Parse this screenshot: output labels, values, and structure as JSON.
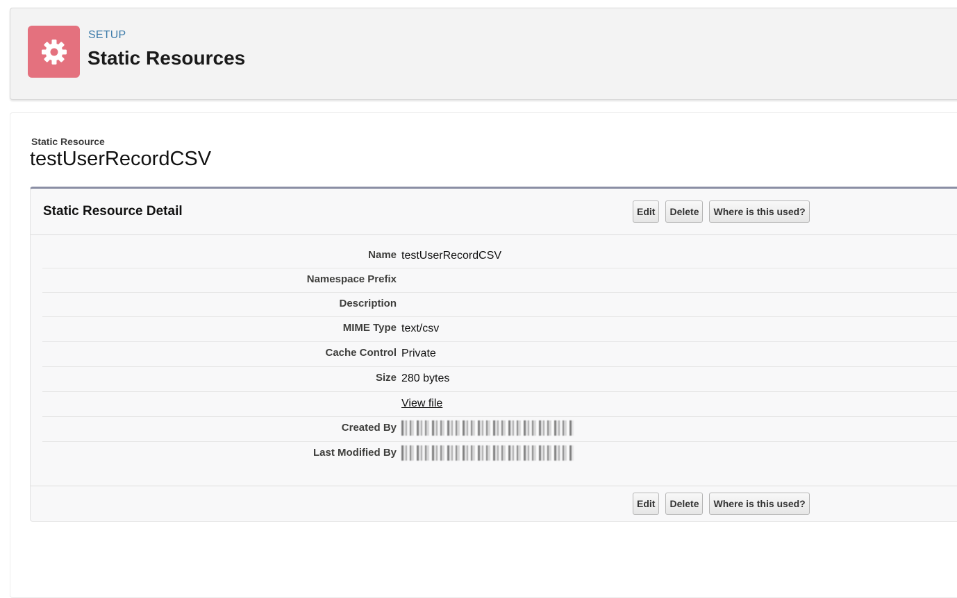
{
  "header": {
    "eyebrow": "SETUP",
    "title": "Static Resources",
    "icon": "gear-icon",
    "icon_color": "#e4717e"
  },
  "record": {
    "type_label": "Static Resource",
    "name": "testUserRecordCSV"
  },
  "detail": {
    "title": "Static Resource Detail",
    "buttons": {
      "edit": "Edit",
      "delete": "Delete",
      "where_used": "Where is this used?"
    },
    "fields": {
      "name": {
        "label": "Name",
        "value": "testUserRecordCSV"
      },
      "namespace_prefix": {
        "label": "Namespace Prefix",
        "value": ""
      },
      "description": {
        "label": "Description",
        "value": ""
      },
      "mime_type": {
        "label": "MIME Type",
        "value": "text/csv"
      },
      "cache_control": {
        "label": "Cache Control",
        "value": "Private"
      },
      "size": {
        "label": "Size",
        "value": "280 bytes"
      },
      "view_file": {
        "label": "",
        "value": "View file"
      },
      "created_by": {
        "label": "Created By"
      },
      "last_modified_by": {
        "label": "Last Modified By"
      }
    }
  }
}
